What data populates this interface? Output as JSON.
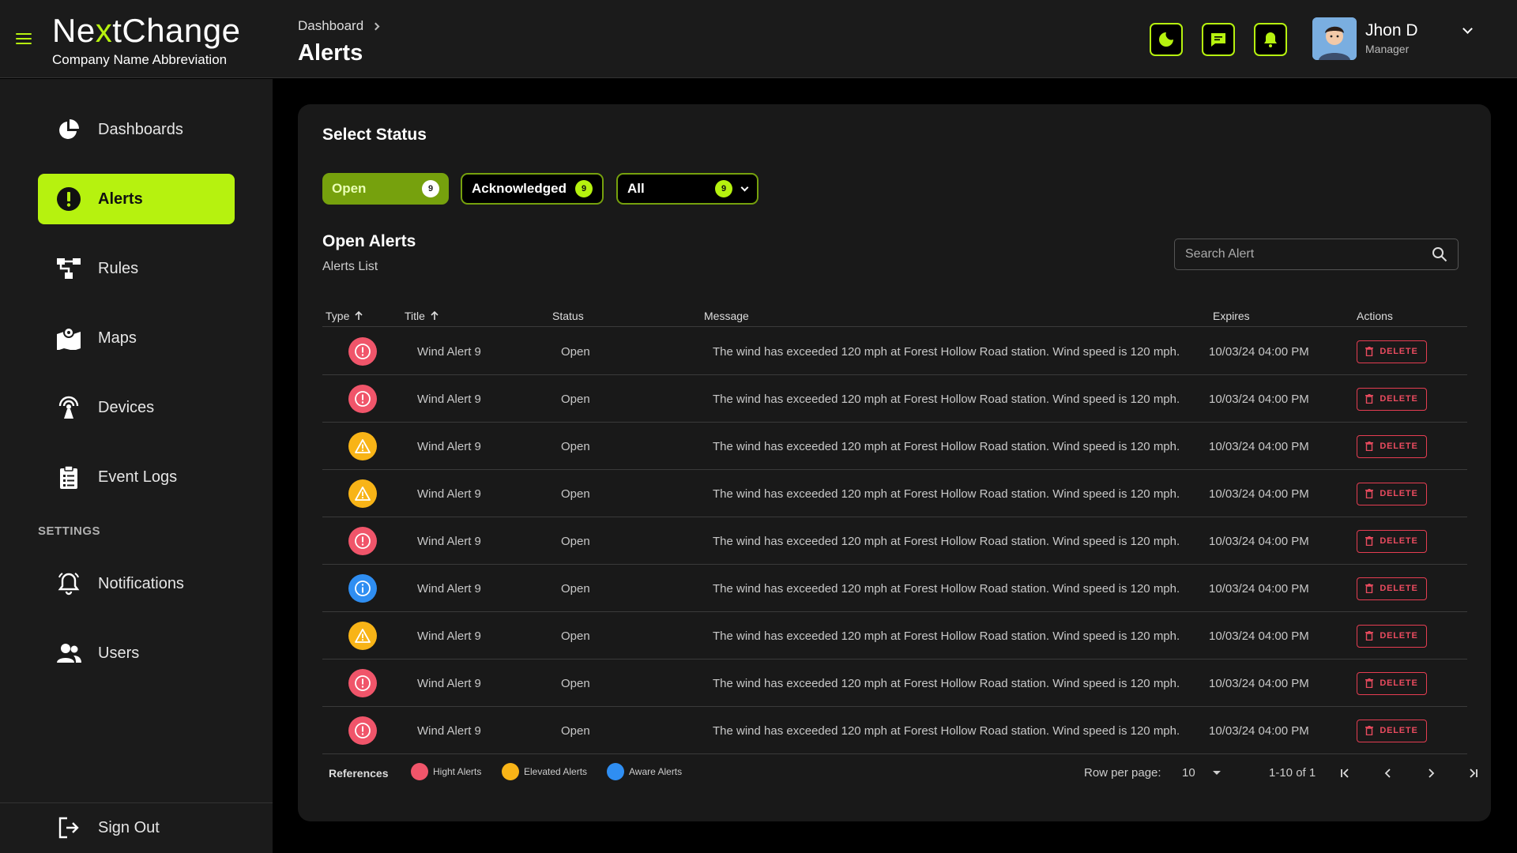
{
  "header": {
    "brand_prefix": "Ne",
    "brand_accent": "x",
    "brand_suffix": "tChange",
    "brand_subtitle": "Company Name Abbreviation",
    "breadcrumb": "Dashboard",
    "page_title": "Alerts",
    "icons": [
      "moon-icon",
      "chat-icon",
      "bell-icon"
    ],
    "user": {
      "name": "Jhon D",
      "role": "Manager"
    }
  },
  "sidebar": {
    "items": [
      {
        "label": "Dashboards",
        "icon": "pie-chart-icon"
      },
      {
        "label": "Alerts",
        "icon": "alert-circle-icon",
        "active": true
      },
      {
        "label": "Rules",
        "icon": "flow-icon"
      },
      {
        "label": "Maps",
        "icon": "map-icon"
      },
      {
        "label": "Devices",
        "icon": "antenna-icon"
      },
      {
        "label": "Event Logs",
        "icon": "clipboard-icon"
      }
    ],
    "settings_heading": "SETTINGS",
    "settings_items": [
      {
        "label": "Notifications",
        "icon": "bell-icon"
      },
      {
        "label": "Users",
        "icon": "users-icon"
      }
    ],
    "sign_out": "Sign Out"
  },
  "main": {
    "select_status": "Select Status",
    "chips": {
      "open": {
        "label": "Open",
        "count": "9"
      },
      "acknowledged": {
        "label": "Acknowledged",
        "count": "9"
      },
      "all": {
        "label": "All",
        "count": "9"
      }
    },
    "section_title": "Open Alerts",
    "section_subtitle": "Alerts List",
    "search_placeholder": "Search Alert",
    "columns": [
      "Type",
      "Title",
      "Status",
      "Message",
      "Expires",
      "Actions"
    ],
    "rows": [
      {
        "type": "high",
        "title": "Wind Alert 9",
        "status": "Open",
        "message": "The wind has exceeded 120 mph at Forest Hollow Road station. Wind speed is 120 mph.",
        "expires": "10/03/24 04:00 PM",
        "action": "DELETE"
      },
      {
        "type": "high",
        "title": "Wind Alert 9",
        "status": "Open",
        "message": "The wind has exceeded 120 mph at Forest Hollow Road station. Wind speed is 120 mph.",
        "expires": "10/03/24 04:00 PM",
        "action": "DELETE"
      },
      {
        "type": "elevated",
        "title": "Wind Alert 9",
        "status": "Open",
        "message": "The wind has exceeded 120 mph at Forest Hollow Road station. Wind speed is 120 mph.",
        "expires": "10/03/24 04:00 PM",
        "action": "DELETE"
      },
      {
        "type": "elevated",
        "title": "Wind Alert 9",
        "status": "Open",
        "message": "The wind has exceeded 120 mph at Forest Hollow Road station. Wind speed is 120 mph.",
        "expires": "10/03/24 04:00 PM",
        "action": "DELETE"
      },
      {
        "type": "high",
        "title": "Wind Alert 9",
        "status": "Open",
        "message": "The wind has exceeded 120 mph at Forest Hollow Road station. Wind speed is 120 mph.",
        "expires": "10/03/24 04:00 PM",
        "action": "DELETE"
      },
      {
        "type": "aware",
        "title": "Wind Alert 9",
        "status": "Open",
        "message": "The wind has exceeded 120 mph at Forest Hollow Road station. Wind speed is 120 mph.",
        "expires": "10/03/24 04:00 PM",
        "action": "DELETE"
      },
      {
        "type": "elevated",
        "title": "Wind Alert 9",
        "status": "Open",
        "message": "The wind has exceeded 120 mph at Forest Hollow Road station. Wind speed is 120 mph.",
        "expires": "10/03/24 04:00 PM",
        "action": "DELETE"
      },
      {
        "type": "high",
        "title": "Wind Alert 9",
        "status": "Open",
        "message": "The wind has exceeded 120 mph at Forest Hollow Road station. Wind speed is 120 mph.",
        "expires": "10/03/24 04:00 PM",
        "action": "DELETE"
      },
      {
        "type": "high",
        "title": "Wind Alert 9",
        "status": "Open",
        "message": "The wind has exceeded 120 mph at Forest Hollow Road station. Wind speed is 120 mph.",
        "expires": "10/03/24 04:00 PM",
        "action": "DELETE"
      }
    ],
    "footer": {
      "references_label": "References",
      "refs": [
        {
          "type": "high",
          "label": "Hight Alerts"
        },
        {
          "type": "elevated",
          "label": "Elevated Alerts"
        },
        {
          "type": "aware",
          "label": "Aware Alerts"
        }
      ],
      "rows_per_page_label": "Row per page:",
      "rows_per_page_value": "10",
      "range": "1-10 of 1"
    }
  },
  "colors": {
    "accent": "#b6f20f",
    "high": "#f0556a",
    "elevated": "#f8b417",
    "aware": "#2f8ef2",
    "delete": "#e53d52"
  }
}
